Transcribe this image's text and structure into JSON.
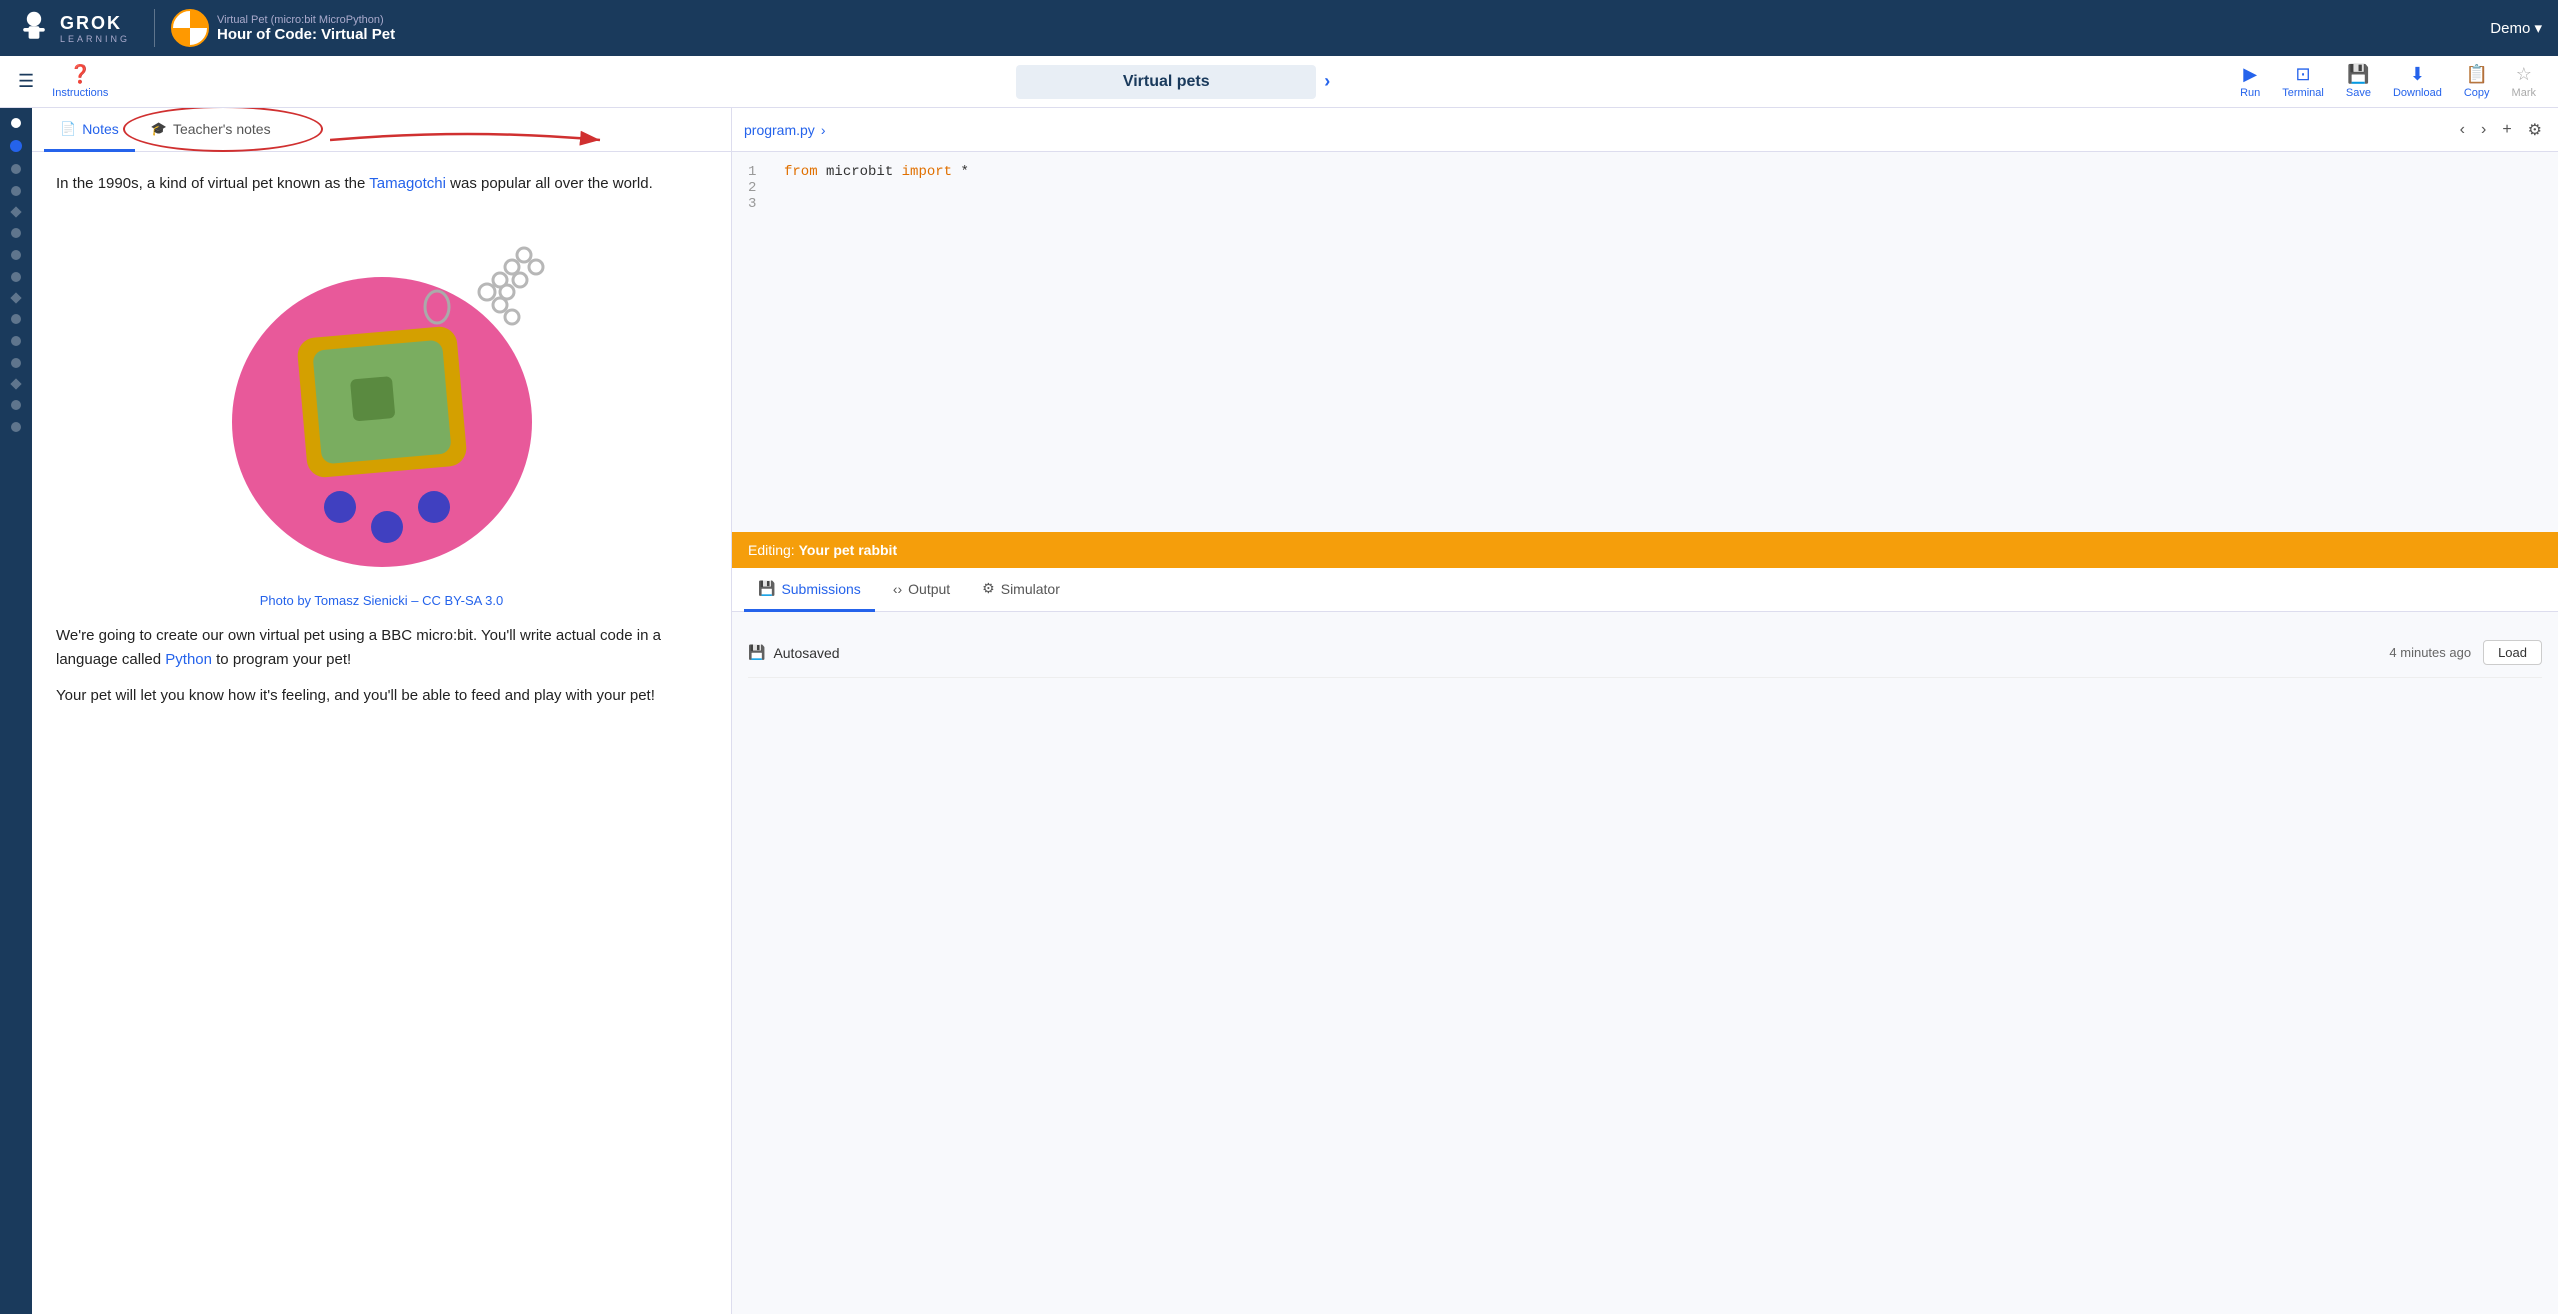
{
  "topNav": {
    "logoGrok": "GROK",
    "logoLearning": "LEARNING",
    "courseSubtitle": "Virtual Pet (micro:bit MicroPython)",
    "courseTitle": "Hour of Code: Virtual Pet",
    "demoLabel": "Demo ▾"
  },
  "toolbar": {
    "instructionsLabel": "Instructions",
    "lessonTitle": "Virtual pets",
    "runLabel": "Run",
    "terminalLabel": "Terminal",
    "saveLabel": "Save",
    "downloadLabel": "Download",
    "copyLabel": "Copy",
    "markLabel": "Mark"
  },
  "tabs": {
    "notes": "Notes",
    "teachersNotes": "Teacher's notes"
  },
  "instructions": {
    "intro": "In the 1990s, a kind of virtual pet known as the Tamagotchi was popular all over the world.",
    "tamagotchiWord": "Tamagotchi",
    "photoCredit": "Photo by Tomasz Sienicki – CC BY-SA 3.0",
    "body1": "We're going to create our own virtual pet using a BBC micro:bit. You'll write actual code in a language called Python to program your pet!",
    "pythonWord": "Python",
    "body2": "Your pet will let you know how it's feeling, and you'll be able to feed and play with your pet!"
  },
  "codeEditor": {
    "filename": "program.py",
    "lines": [
      {
        "num": "1",
        "content": "from microbit import *"
      },
      {
        "num": "2",
        "content": ""
      },
      {
        "num": "3",
        "content": ""
      }
    ]
  },
  "editingBar": {
    "prefix": "Editing:",
    "name": "Your pet rabbit"
  },
  "bottomTabs": {
    "submissions": "Submissions",
    "output": "Output",
    "simulator": "Simulator"
  },
  "submission": {
    "autosaved": "Autosaved",
    "timeAgo": "4 minutes ago",
    "loadLabel": "Load"
  },
  "steps": [
    {
      "type": "dot",
      "active": false
    },
    {
      "type": "dot",
      "active": true
    },
    {
      "type": "dot",
      "active": false
    },
    {
      "type": "dot",
      "active": false
    },
    {
      "type": "diamond"
    },
    {
      "type": "dot",
      "active": false
    },
    {
      "type": "dot",
      "active": false
    },
    {
      "type": "dot",
      "active": false
    },
    {
      "type": "diamond"
    },
    {
      "type": "dot",
      "active": false
    },
    {
      "type": "dot",
      "active": false
    },
    {
      "type": "dot",
      "active": false
    },
    {
      "type": "diamond"
    },
    {
      "type": "dot",
      "active": false
    },
    {
      "type": "dot",
      "active": false
    }
  ]
}
